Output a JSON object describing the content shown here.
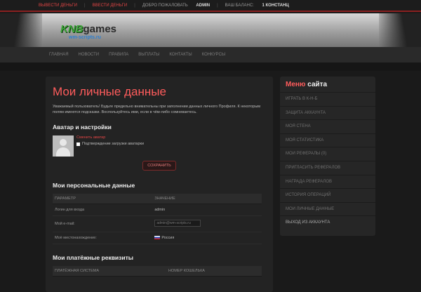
{
  "topbar": {
    "withdraw": "ВЫВЕСТИ ДЕНЬГИ",
    "deposit": "ВВЕСТИ ДЕНЬГИ",
    "welcome": "ДОБРО ПОЖАЛОВАТЬ",
    "username": "ADMIN",
    "balance_label": "ВАШ БАЛАНС:",
    "balance_value": "1 КОНСТАНЦ"
  },
  "logo": {
    "knb": "KNB",
    "games": "games",
    "sub": "wm-scripts.ru"
  },
  "nav": [
    "ГЛАВНАЯ",
    "НОВОСТИ",
    "ПРАВИЛА",
    "ВЫПЛАТЫ",
    "КОНТАКТЫ",
    "КОНКУРСЫ"
  ],
  "main": {
    "title": "Мои личные данные",
    "intro": "Уважаемый пользователь! Будьте предельно внимательны при заполнении данных личного Профиля. К некоторым полям имеются подсказки. Воспользуйтесь ими, если в чём-либо сомневаетесь.",
    "avatar_heading": "Аватар и настройки",
    "change_avatar": "Сменить аватар",
    "confirm_upload": "Подтверждение загрузки аватарки",
    "save": "СОХРАНИТЬ",
    "personal_heading": "Мои персональные данные",
    "personal_cols": [
      "ПАРАМЕТР",
      "ЗНАЧЕНИЕ"
    ],
    "personal_rows": [
      {
        "param": "Логин для входа",
        "value": "admin"
      },
      {
        "param": "Мой e-mail:",
        "value": "admin@wm-scripts.ru"
      },
      {
        "param": "Моё местонахождение:",
        "value": "Россия"
      }
    ],
    "payment_heading": "Мои платёжные реквизиты",
    "payment_cols": [
      "ПЛАТЁЖНАЯ СИСТЕМА",
      "НОМЕР КОШЕЛЬКА"
    ]
  },
  "sidebar": {
    "title_red": "Меню",
    "title_white": "сайта",
    "items": [
      "ИГРАТЬ В К-Н-Б",
      "ЗАЩИТА АККАУНТА",
      "МОЯ СТЕНА",
      "МОЯ СТАТИСТИКА",
      "МОИ РЕФЕРАЛЫ (0)",
      "ПРИГЛАСИТЬ РЕФЕРАЛОВ",
      "НАГРАДА РЕФЕРАЛОВ",
      "ИСТОРИЯ ОПЕРАЦИЙ",
      "МОИ ЛИЧНЫЕ ДАННЫЕ",
      "ВЫХОД ИЗ АККАУНТА"
    ]
  }
}
